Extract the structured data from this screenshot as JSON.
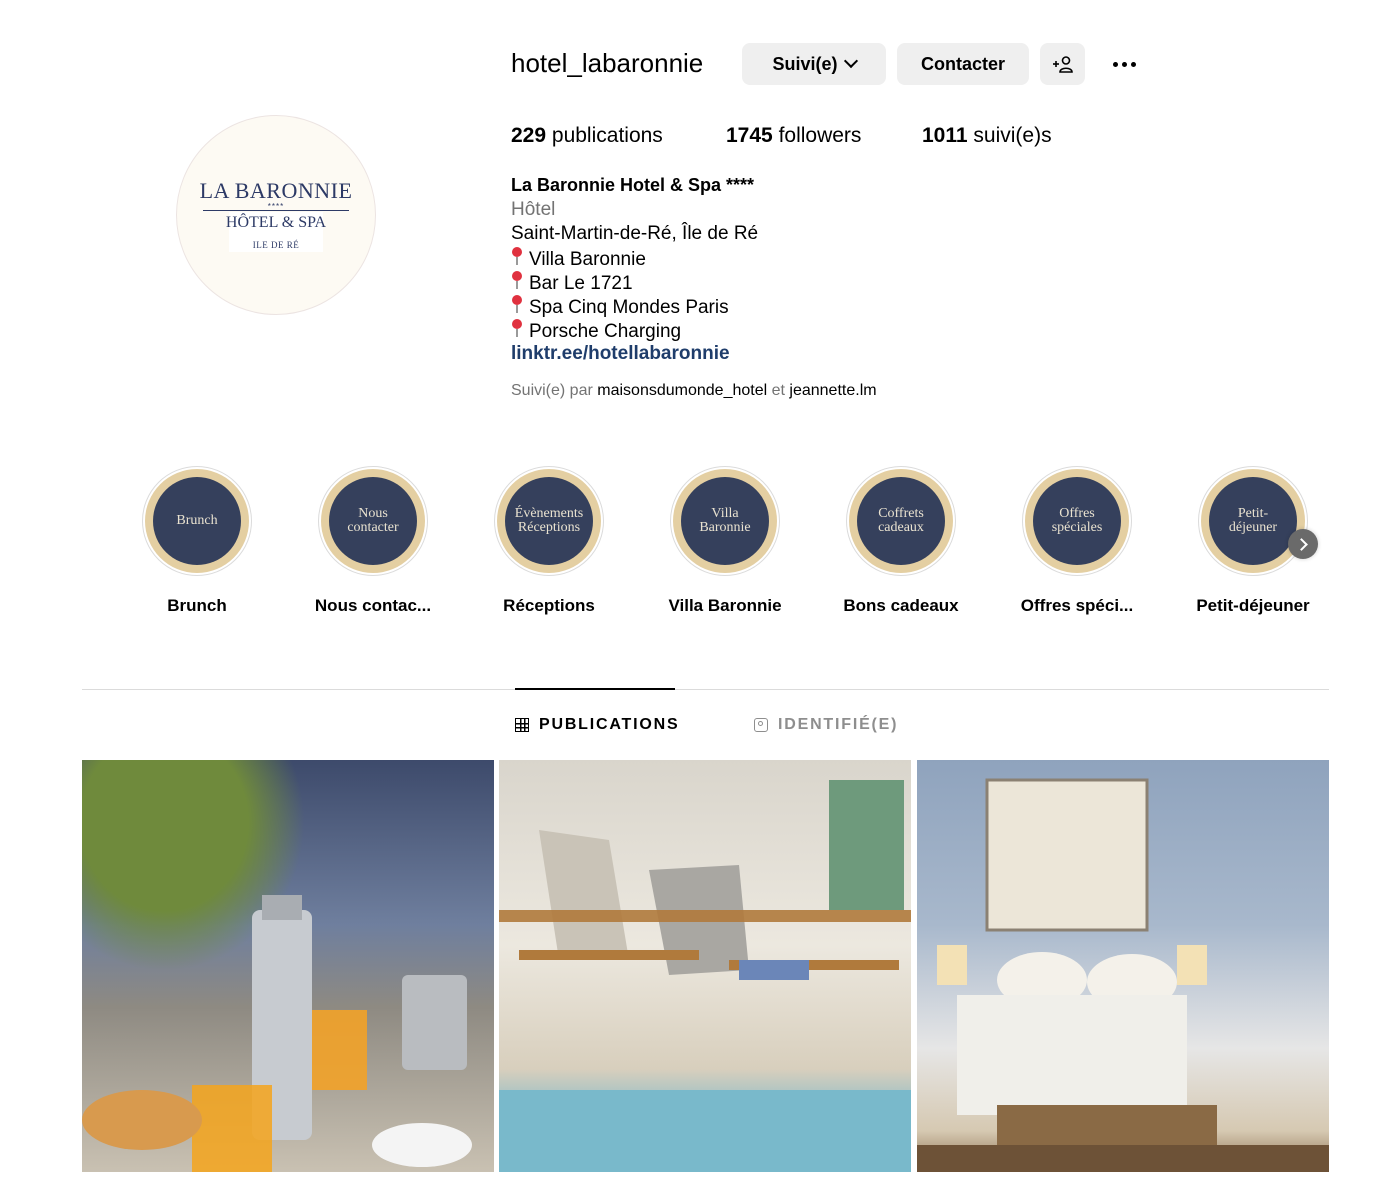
{
  "profile": {
    "username": "hotel_labaronnie",
    "avatar": {
      "line1": "LA BARONNIE",
      "stars": "****",
      "line2": "HÔTEL & SPA",
      "line3": "ILE DE RÉ"
    },
    "buttons": {
      "follow": "Suivi(e)",
      "contact": "Contacter",
      "add_user_icon": "add-user-icon",
      "more_icon": "more-options-icon"
    },
    "stats": {
      "publications_count": "229",
      "publications_label": "publications",
      "followers_count": "1745",
      "followers_label": "followers",
      "following_count": "1011",
      "following_label": "suivi(e)s"
    },
    "bio": {
      "name": "La Baronnie Hotel & Spa ****",
      "category": "Hôtel",
      "location": "Saint-Martin-de-Ré, Île de Ré",
      "lines": [
        "Villa Baronnie",
        "Bar Le 1721",
        "Spa Cinq Mondes Paris",
        "Porsche Charging"
      ],
      "link": "linktr.ee/hotellabaronnie"
    },
    "followed_by": {
      "prefix": "Suivi(e) par",
      "user1": "maisonsdumonde_hotel",
      "conj": "et",
      "user2": "jeannette.lm"
    }
  },
  "highlights": [
    {
      "cover": "Brunch",
      "label": "Brunch"
    },
    {
      "cover": "Nous contacter",
      "label": "Nous contac..."
    },
    {
      "cover": "Évènements Réceptions",
      "label": "Réceptions"
    },
    {
      "cover": "Villa Baronnie",
      "label": "Villa Baronnie"
    },
    {
      "cover": "Coffrets cadeaux",
      "label": "Bons cadeaux"
    },
    {
      "cover": "Offres spéciales",
      "label": "Offres spéci..."
    },
    {
      "cover": "Petit-déjeuner",
      "label": "Petit-déjeuner"
    }
  ],
  "tabs": {
    "publications": "PUBLICATIONS",
    "tagged": "IDENTIFIÉ(E)"
  },
  "colors": {
    "highlight_bg": "#35405c",
    "highlight_ring": "#e4cfa2",
    "link": "#1f3d6b"
  }
}
